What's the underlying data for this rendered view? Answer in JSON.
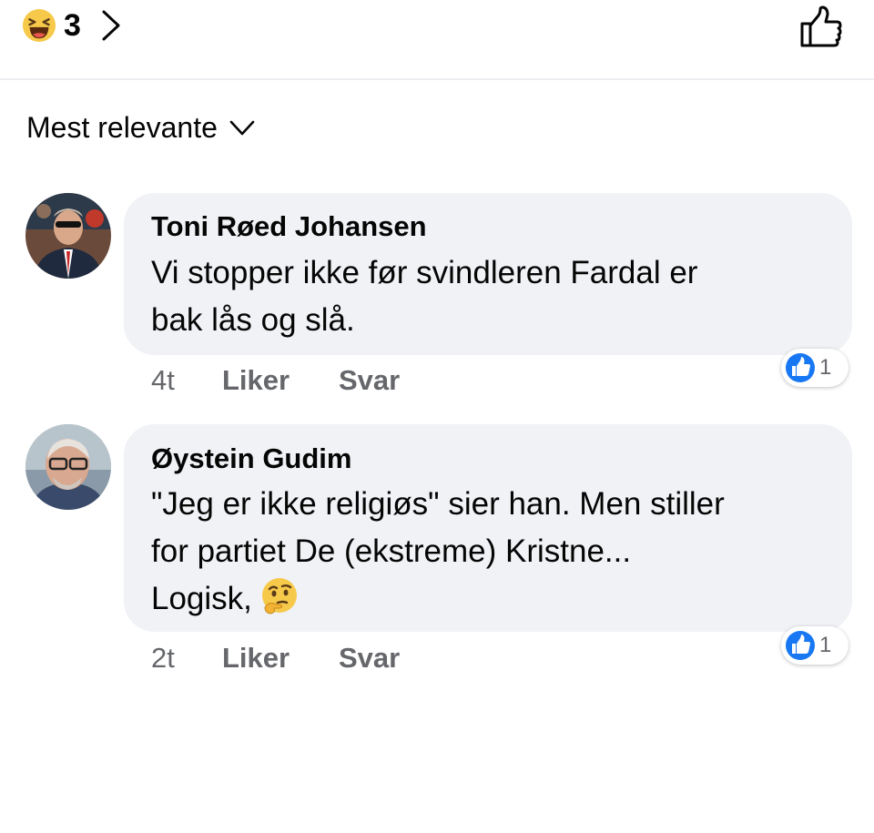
{
  "reactions": {
    "count": "3",
    "icon": "haha-icon"
  },
  "sort": {
    "label": "Mest relevante"
  },
  "comments": [
    {
      "author": "Toni Røed Johansen",
      "lines": [
        "Vi stopper ikke før svindleren Fardal er",
        "bak lås og slå."
      ],
      "time": "4t",
      "like_label": "Liker",
      "reply_label": "Svar",
      "like_count": "1"
    },
    {
      "author": "Øystein Gudim",
      "lines": [
        "\"Jeg er ikke religiøs\" sier han. Men stiller",
        "for partiet De (ekstreme) Kristne...",
        "Logisk,"
      ],
      "trailing_emoji": "thinking-face-emoji",
      "time": "2t",
      "like_label": "Liker",
      "reply_label": "Svar",
      "like_count": "1"
    }
  ],
  "colors": {
    "like_blue": "#1877f2",
    "muted": "#65676b",
    "bubble": "#f0f2f5"
  }
}
